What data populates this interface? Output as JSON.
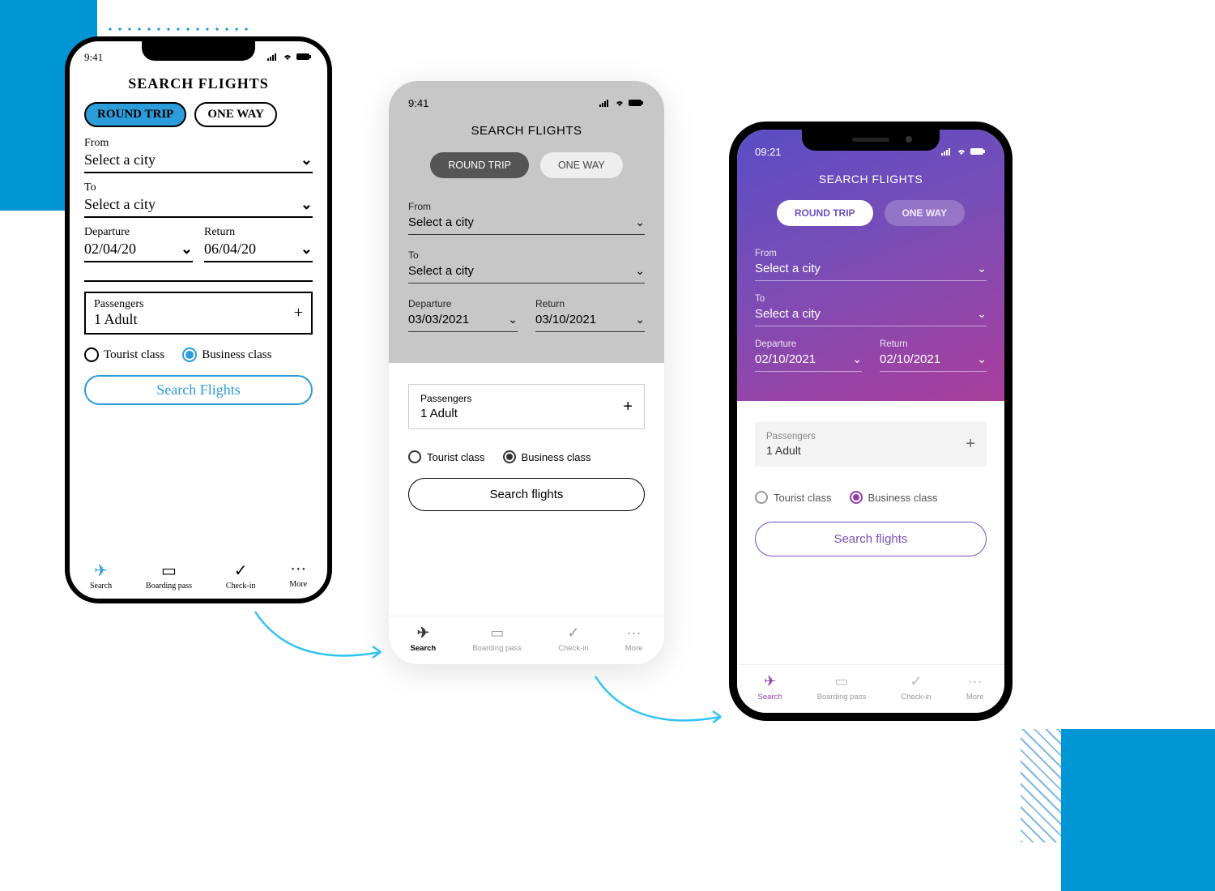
{
  "sketch": {
    "status_time": "9:41",
    "title": "SEARCH FLIGHTS",
    "trip_round": "ROUND TRIP",
    "trip_oneway": "ONE WAY",
    "from_label": "From",
    "from_value": "Select a city",
    "to_label": "To",
    "to_value": "Select a city",
    "dep_label": "Departure",
    "dep_value": "02/04/20",
    "ret_label": "Return",
    "ret_value": "06/04/20",
    "pass_label": "Passengers",
    "pass_value": "1 Adult",
    "class_tourist": "Tourist class",
    "class_business": "Business class",
    "search_btn": "Search Flights",
    "nav": {
      "search": "Search",
      "boarding": "Boarding pass",
      "checkin": "Check-in",
      "more": "More"
    }
  },
  "gray": {
    "status_time": "9:41",
    "title": "SEARCH FLIGHTS",
    "trip_round": "ROUND TRIP",
    "trip_oneway": "ONE WAY",
    "from_label": "From",
    "from_value": "Select a city",
    "to_label": "To",
    "to_value": "Select a city",
    "dep_label": "Departure",
    "dep_value": "03/03/2021",
    "ret_label": "Return",
    "ret_value": "03/10/2021",
    "pass_label": "Passengers",
    "pass_value": "1 Adult",
    "class_tourist": "Tourist class",
    "class_business": "Business class",
    "search_btn": "Search flights",
    "nav": {
      "search": "Search",
      "boarding": "Boarding pass",
      "checkin": "Check-in",
      "more": "More"
    }
  },
  "color": {
    "status_time": "09:21",
    "title": "SEARCH FLIGHTS",
    "trip_round": "ROUND TRIP",
    "trip_oneway": "ONE WAY",
    "from_label": "From",
    "from_value": "Select a city",
    "to_label": "To",
    "to_value": "Select a city",
    "dep_label": "Departure",
    "dep_value": "02/10/2021",
    "ret_label": "Return",
    "ret_value": "02/10/2021",
    "pass_label": "Passengers",
    "pass_value": "1 Adult",
    "class_tourist": "Tourist class",
    "class_business": "Business class",
    "search_btn": "Search flights",
    "nav": {
      "search": "Search",
      "boarding": "Boarding pass",
      "checkin": "Check-in",
      "more": "More"
    }
  }
}
